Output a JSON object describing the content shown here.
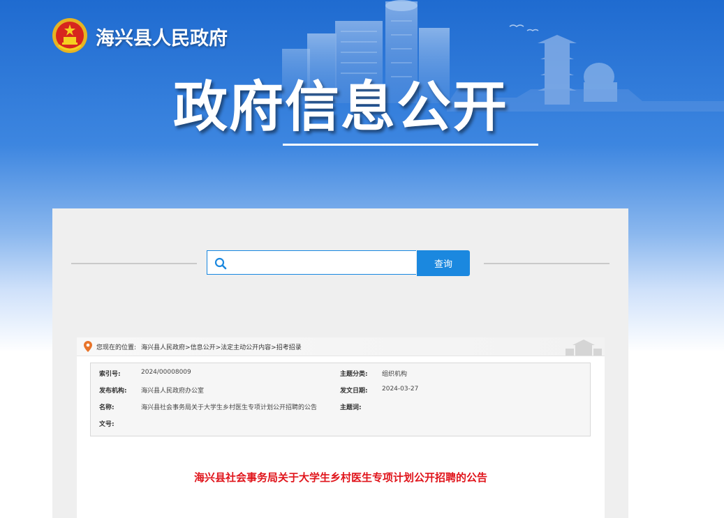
{
  "header": {
    "site_name": "海兴县人民政府",
    "banner_title": "政府信息公开"
  },
  "search": {
    "placeholder": "",
    "value": "",
    "button_label": "查询"
  },
  "breadcrumb": {
    "label": "您现在的位置:",
    "items": [
      "海兴县人民政府",
      "信息公开",
      "法定主动公开内容",
      "招考招录"
    ],
    "separator": ">"
  },
  "meta": {
    "index_no_label": "索引号:",
    "index_no": "2024/00008009",
    "topic_label": "主题分类:",
    "topic": "组织机构",
    "publisher_label": "发布机构:",
    "publisher": "海兴县人民政府办公室",
    "date_label": "发文日期:",
    "date": "2024-03-27",
    "name_label": "名称:",
    "name": "海兴县社会事务局关于大学生乡村医生专项计划公开招聘的公告",
    "keywords_label": "主题词:",
    "keywords": "",
    "doc_no_label": "文号:",
    "doc_no": ""
  },
  "document": {
    "title": "海兴县社会事务局关于大学生乡村医生专项计划公开招聘的公告"
  },
  "icons": {
    "emblem": "national-emblem-icon",
    "search": "search-icon",
    "location": "location-pin-icon"
  },
  "colors": {
    "accent_blue": "#1b88df",
    "title_red": "#e0141b",
    "banner_blue": "#1f6bd0"
  }
}
